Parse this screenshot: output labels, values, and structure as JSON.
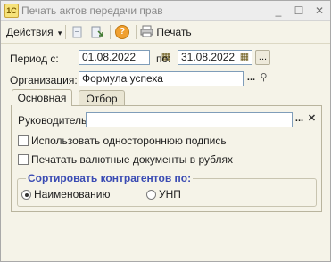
{
  "window": {
    "title": "Печать актов передачи прав",
    "app_icon_glyph": "1С",
    "controls": {
      "minimize": "_",
      "maximize": "☐",
      "close": "✕"
    }
  },
  "toolbar": {
    "actions_label": "Действия",
    "actions_arrow": "▾",
    "help_glyph": "?",
    "print_label": "Печать"
  },
  "period": {
    "label": "Период с:",
    "from": "01.08.2022",
    "to_label": "по:",
    "to": "31.08.2022",
    "more_button": "..."
  },
  "organization": {
    "label": "Организация:",
    "value": "Формула успеха",
    "select_button": "...",
    "open_glyph": "⚲"
  },
  "tabs": [
    {
      "label": "Основная",
      "active": true
    },
    {
      "label": "Отбор",
      "active": false
    }
  ],
  "main_tab": {
    "manager_label": "Руководитель:",
    "manager_value": "",
    "select_button": "...",
    "clear_button": "✕",
    "one_sided_signature": "Использовать одностороннюю подпись",
    "currency_in_rubles": "Печатать валютные документы в рублях",
    "sort_group_title": "Сортировать контрагентов по:",
    "sort_options": [
      {
        "label": "Наименованию",
        "selected": true
      },
      {
        "label": "УНП",
        "selected": false
      }
    ]
  },
  "colors": {
    "window_bg": "#f5f3e8",
    "group_title": "#3a4bb3",
    "field_border": "#7f9db9"
  }
}
